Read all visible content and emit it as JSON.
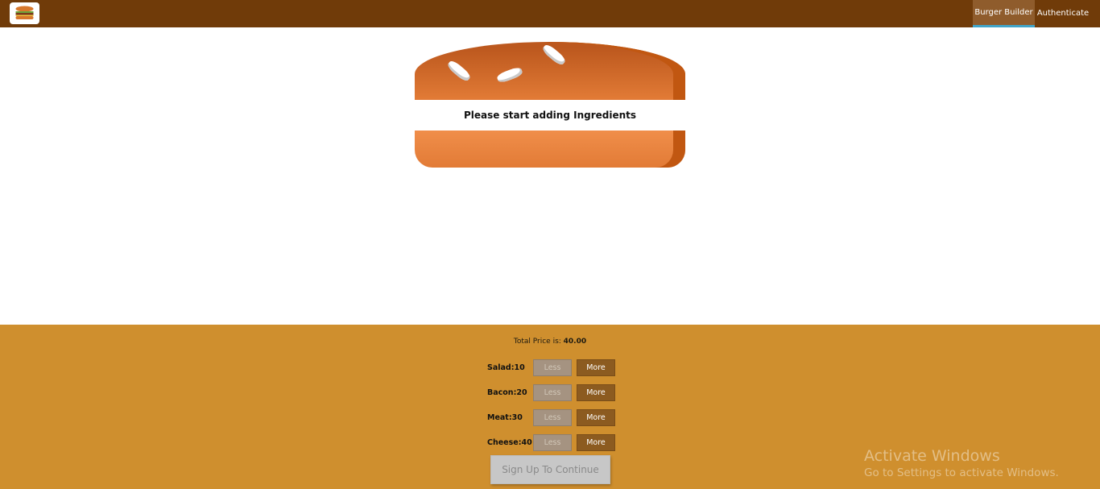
{
  "toolbar": {
    "logo_icon": "burger-logo-icon",
    "nav": [
      {
        "label": "Burger Builder",
        "active": true
      },
      {
        "label": "Authenticate",
        "active": false
      }
    ]
  },
  "burger": {
    "message": "Please start adding Ingredients"
  },
  "controls": {
    "price_label": "Total Price is: ",
    "price_value": "40.00",
    "ingredients": [
      {
        "label": "Salad:10",
        "less": "Less",
        "more": "More",
        "less_disabled": true
      },
      {
        "label": "Bacon:20",
        "less": "Less",
        "more": "More",
        "less_disabled": true
      },
      {
        "label": "Meat:30",
        "less": "Less",
        "more": "More",
        "less_disabled": true
      },
      {
        "label": "Cheese:40",
        "less": "Less",
        "more": "More",
        "less_disabled": true
      }
    ],
    "order_button": "Sign Up To Continue",
    "order_disabled": true
  },
  "watermark": {
    "title": "Activate Windows",
    "subtitle": "Go to Settings to activate Windows."
  },
  "colors": {
    "toolbar": "#703b09",
    "nav_active": "#8f5c2c",
    "controls_bg": "#cf8f2e",
    "more_button": "#8c5b20",
    "less_button_disabled": "#a59381"
  }
}
